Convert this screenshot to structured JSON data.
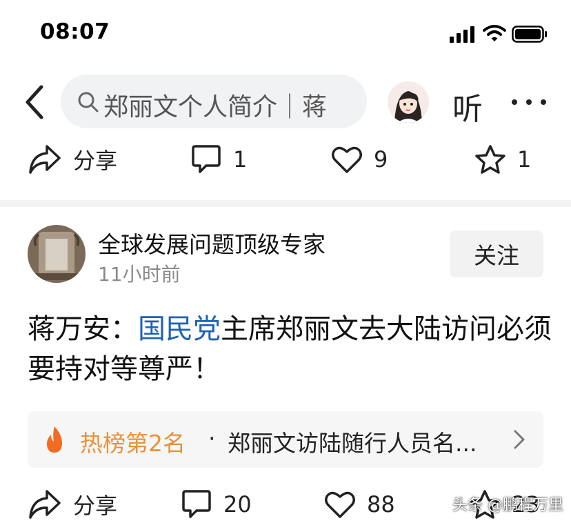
{
  "status_bar": {
    "time": "08:07"
  },
  "search_bar": {
    "query": "郑丽文个人简介｜蒋",
    "listen_label": "听"
  },
  "top_actions": {
    "share_label": "分享",
    "comment_count": "1",
    "like_count": "9",
    "favorite_count": "1"
  },
  "post": {
    "author_name": "全球发展问题顶级专家",
    "time": "11小时前",
    "follow_label": "关注",
    "body_prefix": "蒋万安：",
    "body_link": "国民党",
    "body_suffix": "主席郑丽文去大陆访问必须要持对等尊严！",
    "hot": {
      "rank_label": "热榜第2名",
      "separator": "·",
      "title": "郑丽文访陆随行人员名..."
    },
    "actions": {
      "share_label": "分享",
      "comment_count": "20",
      "like_count": "88",
      "favorite_count": "23"
    }
  },
  "watermark": "头条 @鹏程万里",
  "colors": {
    "link": "#1f62b4",
    "hot_rank": "#e8913a",
    "flame": "#f26b21",
    "muted": "#8a8a8a"
  },
  "icons": [
    "back-arrow-icon",
    "search-icon",
    "share-icon",
    "comment-icon",
    "heart-icon",
    "star-icon",
    "flame-icon",
    "chevron-right-icon",
    "more-icon"
  ]
}
